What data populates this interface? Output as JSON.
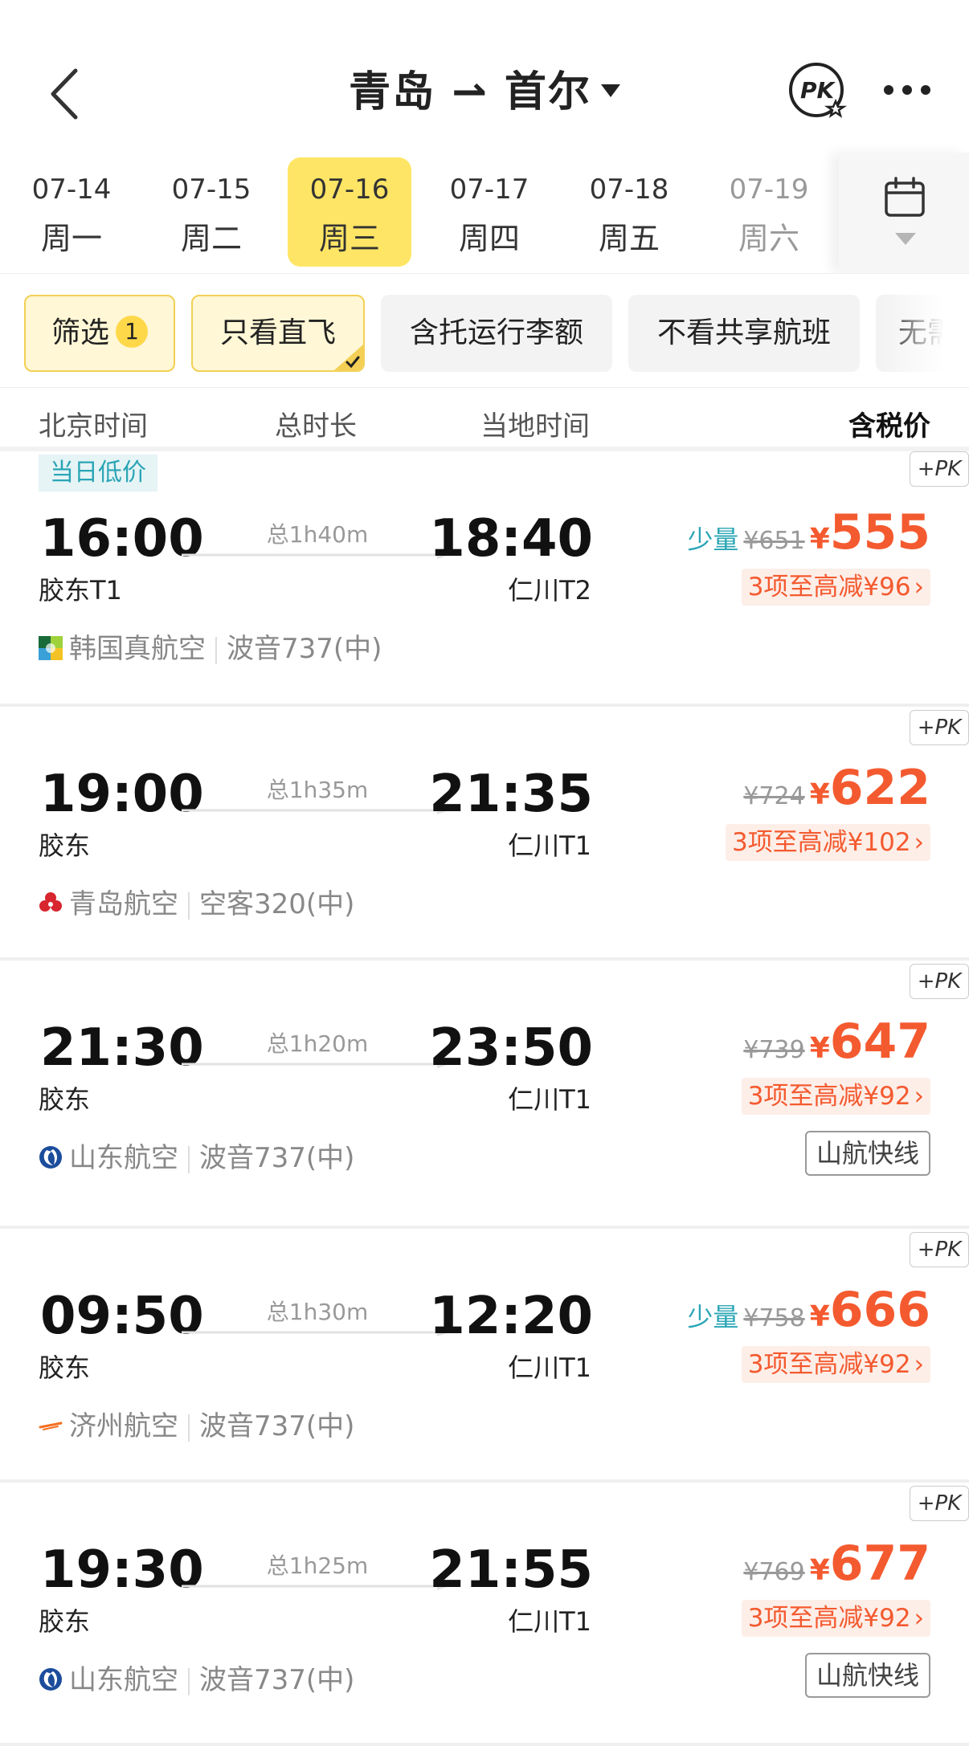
{
  "header": {
    "title": "青岛 ⇀ 首尔",
    "pk_label": "PK"
  },
  "dates": [
    {
      "date": "07-14",
      "weekday": "周一",
      "active": false
    },
    {
      "date": "07-15",
      "weekday": "周二",
      "active": false
    },
    {
      "date": "07-16",
      "weekday": "周三",
      "active": true
    },
    {
      "date": "07-17",
      "weekday": "周四",
      "active": false
    },
    {
      "date": "07-18",
      "weekday": "周五",
      "active": false
    },
    {
      "date": "07-19",
      "weekday": "周六",
      "active": false
    }
  ],
  "filters": {
    "filter_label": "筛选",
    "filter_count": "1",
    "direct_only": "只看直飞",
    "checked_baggage": "含托运行李额",
    "no_codeshare": "不看共享航班",
    "more": "无需"
  },
  "columns": {
    "beijing_time": "北京时间",
    "duration": "总时长",
    "local_time": "当地时间",
    "price_incl_tax": "含税价"
  },
  "flights": [
    {
      "tag": "当日低价",
      "dep_time": "16:00",
      "dep_airport": "胶东T1",
      "duration": "总1h40m",
      "arr_time": "18:40",
      "arr_airport": "仁川T2",
      "airline": "韩国真航空",
      "aircraft": "波音737(中)",
      "logo": "jin-air-logo",
      "scarce": "少量",
      "orig_price": "¥651",
      "currency": "¥",
      "price": "555",
      "discount": "3项至高减¥96",
      "extra_tag": ""
    },
    {
      "tag": "",
      "dep_time": "19:00",
      "dep_airport": "胶东",
      "duration": "总1h35m",
      "arr_time": "21:35",
      "arr_airport": "仁川T1",
      "airline": "青岛航空",
      "aircraft": "空客320(中)",
      "logo": "qingdao-airlines-logo",
      "scarce": "",
      "orig_price": "¥724",
      "currency": "¥",
      "price": "622",
      "discount": "3项至高减¥102",
      "extra_tag": ""
    },
    {
      "tag": "",
      "dep_time": "21:30",
      "dep_airport": "胶东",
      "duration": "总1h20m",
      "arr_time": "23:50",
      "arr_airport": "仁川T1",
      "airline": "山东航空",
      "aircraft": "波音737(中)",
      "logo": "shandong-airlines-logo",
      "scarce": "",
      "orig_price": "¥739",
      "currency": "¥",
      "price": "647",
      "discount": "3项至高减¥92",
      "extra_tag": "山航快线"
    },
    {
      "tag": "",
      "dep_time": "09:50",
      "dep_airport": "胶东",
      "duration": "总1h30m",
      "arr_time": "12:20",
      "arr_airport": "仁川T1",
      "airline": "济州航空",
      "aircraft": "波音737(中)",
      "logo": "jeju-air-logo",
      "scarce": "少量",
      "orig_price": "¥758",
      "currency": "¥",
      "price": "666",
      "discount": "3项至高减¥92",
      "extra_tag": ""
    },
    {
      "tag": "",
      "dep_time": "19:30",
      "dep_airport": "胶东",
      "duration": "总1h25m",
      "arr_time": "21:55",
      "arr_airport": "仁川T1",
      "airline": "山东航空",
      "aircraft": "波音737(中)",
      "logo": "shandong-airlines-logo",
      "scarce": "",
      "orig_price": "¥769",
      "currency": "¥",
      "price": "677",
      "discount": "3项至高减¥92",
      "extra_tag": "山航快线"
    }
  ],
  "pk_add_label": "+PK",
  "colors": {
    "accent_yellow": "#ffe565",
    "price_red": "#f45a2f",
    "teal": "#2aa5b5"
  }
}
